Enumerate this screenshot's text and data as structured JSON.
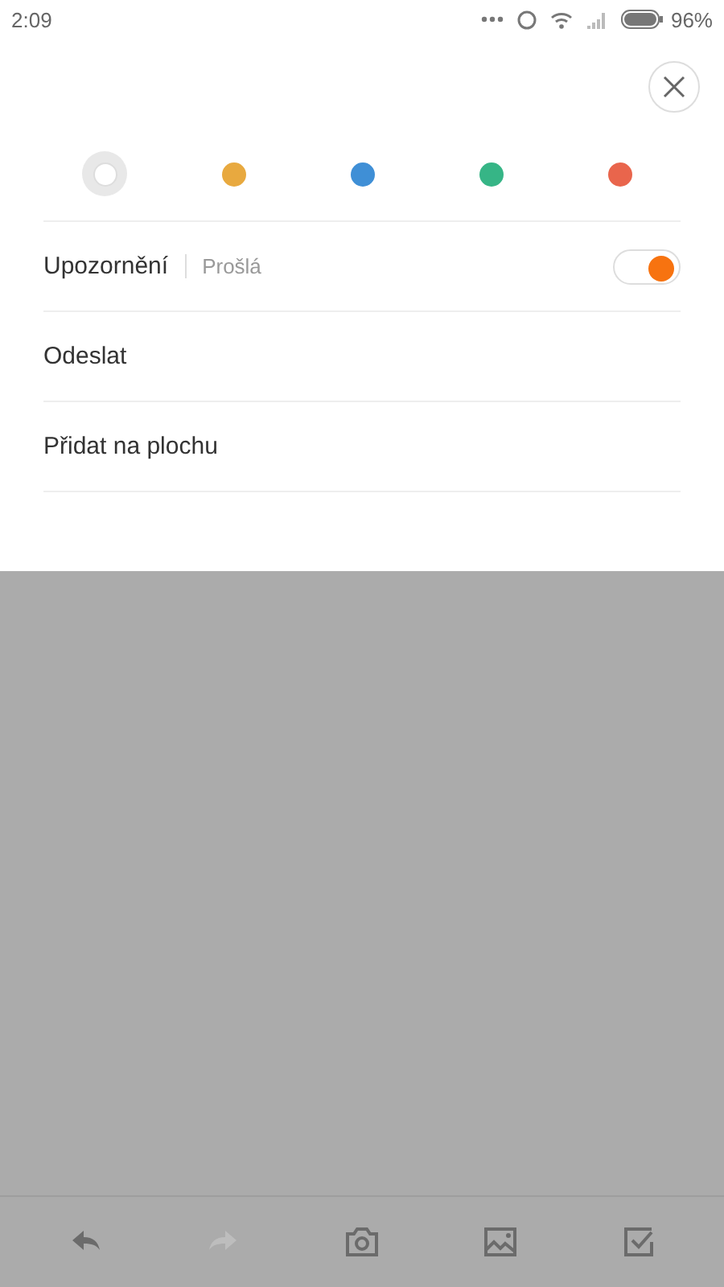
{
  "status_bar": {
    "time": "2:09",
    "battery": "96%"
  },
  "colors": [
    {
      "color": "#ffffff",
      "selected": true
    },
    {
      "color": "#e8a93f",
      "selected": false
    },
    {
      "color": "#3f8fd6",
      "selected": false
    },
    {
      "color": "#36b586",
      "selected": false
    },
    {
      "color": "#e9654c",
      "selected": false
    }
  ],
  "rows": [
    {
      "kind": "toggle",
      "label": "Upozornění",
      "detail": "Prošlá",
      "on": true
    },
    {
      "kind": "plain",
      "label": "Odeslat"
    },
    {
      "kind": "plain",
      "label": "Přidat na plochu"
    }
  ],
  "toolbar": [
    {
      "kind": "undo",
      "disabled": false
    },
    {
      "kind": "redo",
      "disabled": true
    },
    {
      "kind": "camera",
      "disabled": false
    },
    {
      "kind": "image",
      "disabled": false
    },
    {
      "kind": "checklist",
      "disabled": false
    }
  ]
}
